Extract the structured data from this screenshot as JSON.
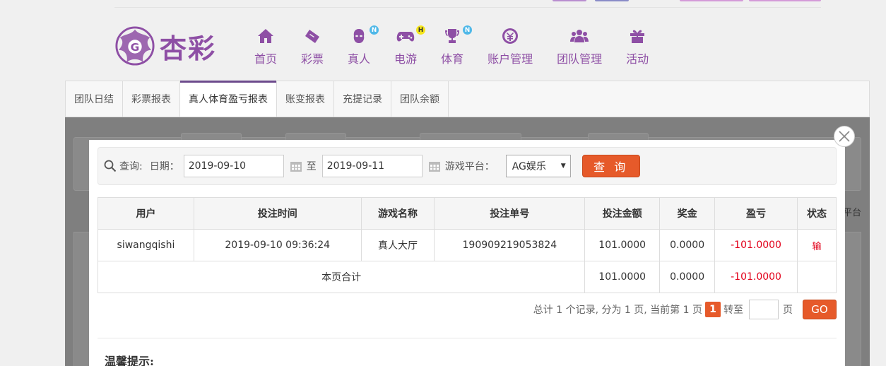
{
  "brand": {
    "name": "杏彩",
    "accent": "#8e4fa5"
  },
  "nav": [
    {
      "label": "首页",
      "icon": "home-icon"
    },
    {
      "label": "彩票",
      "icon": "ticket-icon"
    },
    {
      "label": "真人",
      "icon": "dealer-icon",
      "badge": "N"
    },
    {
      "label": "电游",
      "icon": "gamepad-icon",
      "badge": "H"
    },
    {
      "label": "体育",
      "icon": "trophy-icon",
      "badge": "N"
    },
    {
      "label": "账户管理",
      "icon": "account-icon"
    },
    {
      "label": "团队管理",
      "icon": "team-icon"
    },
    {
      "label": "活动",
      "icon": "gift-icon"
    }
  ],
  "tabs": [
    "团队日结",
    "彩票报表",
    "真人体育盈亏报表",
    "账变报表",
    "充提记录",
    "团队余额"
  ],
  "active_tab": "真人体育盈亏报表",
  "background_label": "平台",
  "search": {
    "query_label": "查询:",
    "date_label": "日期：",
    "start_date": "2019-09-10",
    "to_label": "至",
    "end_date": "2019-09-11",
    "platform_label": "游戏平台：",
    "platform_value": "AG娱乐",
    "query_button": "查 询"
  },
  "table": {
    "headers": [
      "用户",
      "投注时间",
      "游戏名称",
      "投注单号",
      "投注金额",
      "奖金",
      "盈亏",
      "状态"
    ],
    "rows": [
      {
        "user": "siwangqishi",
        "time": "2019-09-10 09:36:24",
        "game": "真人大厅",
        "order": "190909219053824",
        "amount": "101.0000",
        "bonus": "0.0000",
        "profit": "-101.0000",
        "status": "输"
      }
    ],
    "totals": {
      "label": "本页合计",
      "amount": "101.0000",
      "bonus": "0.0000",
      "profit": "-101.0000"
    }
  },
  "pager": {
    "summary": "总计 1 个记录, 分为 1 页, 当前第 1 页",
    "current": "1",
    "goto_label": "转至",
    "page_unit": "页",
    "go_button": "GO"
  },
  "tip_title": "温馨提示:"
}
